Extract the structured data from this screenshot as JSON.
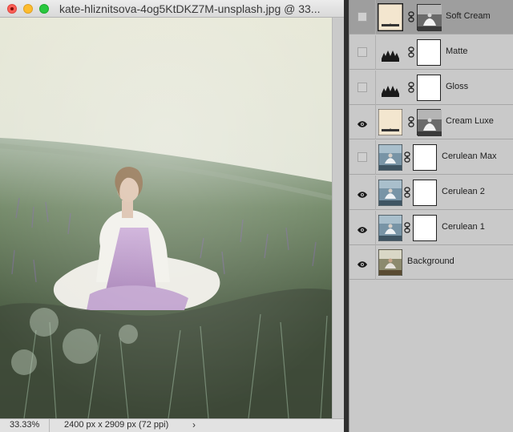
{
  "window": {
    "title": "kate-hliznitsova-4og5KtDKZ7M-unsplash.jpg @ 33...",
    "zoom": "33.33%",
    "doc_info": "2400 px x 2909 px (72 ppi)",
    "status_arrow": "›"
  },
  "layers": [
    {
      "name": "Soft Cream",
      "visible": false,
      "selected": true,
      "thumb": "solid-cream",
      "has_mask": false,
      "mask": "dress-bw"
    },
    {
      "name": "Matte",
      "visible": false,
      "selected": false,
      "thumb": "curves-icon",
      "has_mask": true
    },
    {
      "name": "Gloss",
      "visible": false,
      "selected": false,
      "thumb": "curves-icon",
      "has_mask": true
    },
    {
      "name": "Cream Luxe",
      "visible": true,
      "selected": false,
      "thumb": "solid-cream",
      "has_mask": false,
      "mask": "dress-bw"
    },
    {
      "name": "Cerulean Max",
      "visible": false,
      "selected": false,
      "thumb": "photo-blue",
      "has_mask": true
    },
    {
      "name": "Cerulean 2",
      "visible": true,
      "selected": false,
      "thumb": "photo-blue",
      "has_mask": true
    },
    {
      "name": "Cerulean 1",
      "visible": true,
      "selected": false,
      "thumb": "photo-blue",
      "has_mask": true
    },
    {
      "name": "Background",
      "visible": true,
      "selected": false,
      "thumb": "photo-original",
      "has_mask": false
    }
  ],
  "colors": {
    "panel_bg": "#c9c9c9",
    "selected_row": "#9e9e9e",
    "cream_fill": "#f3e6cf"
  }
}
